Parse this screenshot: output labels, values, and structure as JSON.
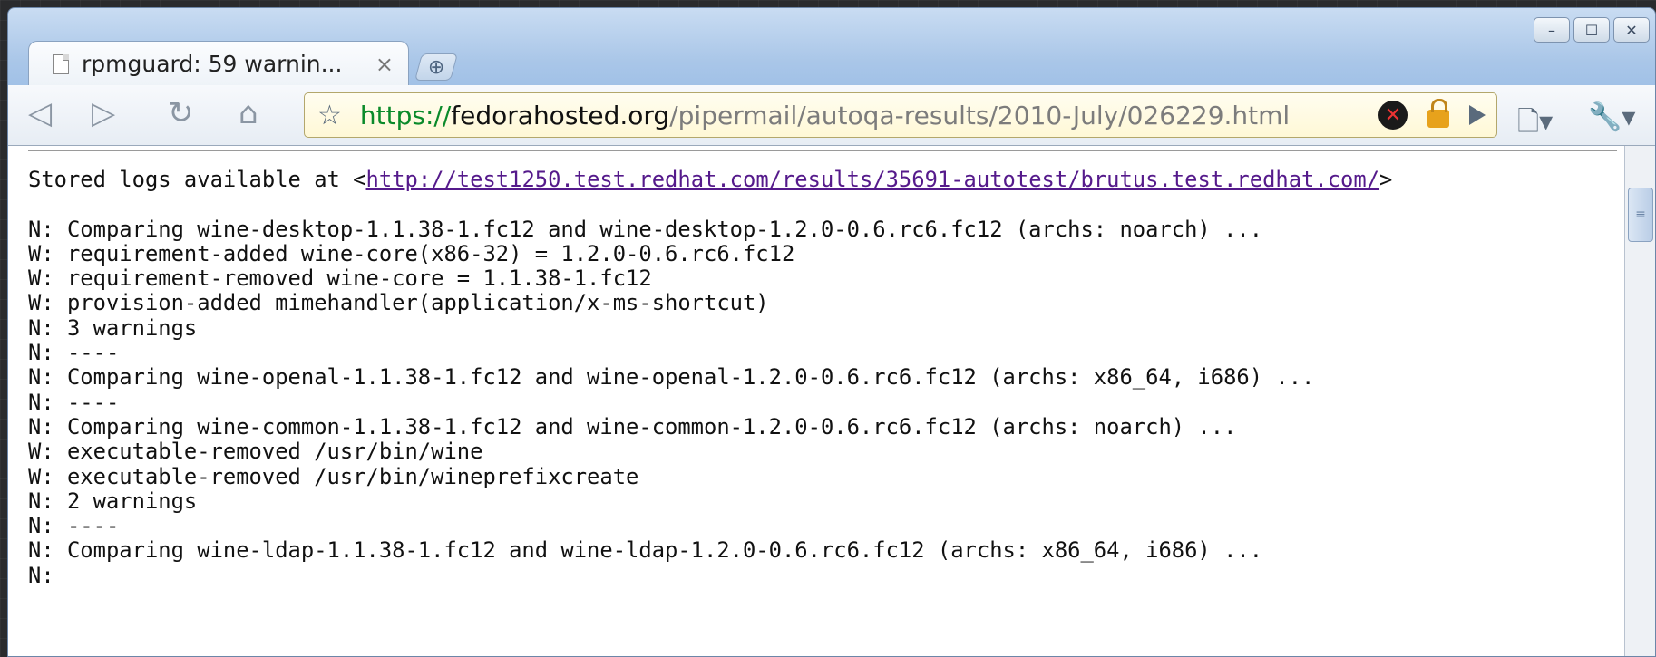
{
  "window": {
    "controls": {
      "minimize": "–",
      "maximize": "☐",
      "close": "✕"
    }
  },
  "tab": {
    "title": "rpmguard: 59 warnin...",
    "close": "×"
  },
  "newtab": {
    "label": "⊕"
  },
  "toolbar": {
    "back": "◁",
    "forward": "▷",
    "reload": "↻",
    "home": "⌂",
    "url": {
      "scheme": "https://",
      "host": "fedorahosted.org",
      "path": "/pipermail/autoqa-results/2010-July/026229.html"
    },
    "page_menu": "🗋▾",
    "wrench_menu": "🔧▾"
  },
  "content": {
    "stored_logs_prefix": "Stored logs available at <",
    "stored_logs_link": "http://test1250.test.redhat.com/results/35691-autotest/brutus.test.redhat.com/",
    "stored_logs_suffix": ">",
    "lines": [
      "N: Comparing wine-desktop-1.1.38-1.fc12 and wine-desktop-1.2.0-0.6.rc6.fc12 (archs: noarch) ...",
      "W: requirement-added wine-core(x86-32) = 1.2.0-0.6.rc6.fc12",
      "W: requirement-removed wine-core = 1.1.38-1.fc12",
      "W: provision-added mimehandler(application/x-ms-shortcut)",
      "N: 3 warnings",
      "N: ----",
      "N: Comparing wine-openal-1.1.38-1.fc12 and wine-openal-1.2.0-0.6.rc6.fc12 (archs: x86_64, i686) ...",
      "N: ----",
      "N: Comparing wine-common-1.1.38-1.fc12 and wine-common-1.2.0-0.6.rc6.fc12 (archs: noarch) ...",
      "W: executable-removed /usr/bin/wine",
      "W: executable-removed /usr/bin/wineprefixcreate",
      "N: 2 warnings",
      "N: ----",
      "N: Comparing wine-ldap-1.1.38-1.fc12 and wine-ldap-1.2.0-0.6.rc6.fc12 (archs: x86_64, i686) ...",
      "N:"
    ]
  }
}
